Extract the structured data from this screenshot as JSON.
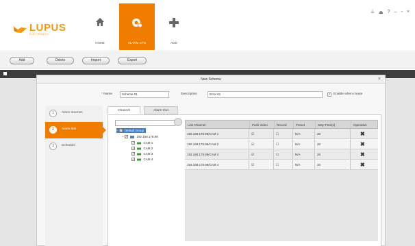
{
  "app": {
    "logo_text": "LUPUS",
    "logo_sub": "ELECTRONICS",
    "brand_color": "#f07c00",
    "window_controls": [
      "≟",
      "⏏",
      "?",
      "–",
      "▫",
      "×"
    ]
  },
  "nav": [
    {
      "label": "HOME",
      "icon": "home-icon",
      "active": false
    },
    {
      "label": "ALARM CFG",
      "icon": "alarm-config-icon",
      "active": true
    },
    {
      "label": "ADD",
      "icon": "plus-icon",
      "active": false
    }
  ],
  "toolbar": {
    "add_label": "Add",
    "delete_label": "Delete",
    "import_label": "Import",
    "export_label": "Export"
  },
  "dialog": {
    "title": "New Scheme",
    "close": "×",
    "name_label": "Name",
    "name_required": "*",
    "name_value": "Scheme 01",
    "description_label": "Description",
    "description_value": "Error 01",
    "enable_label": "Enable when create",
    "enable_checked": true
  },
  "steps": [
    {
      "num": "1",
      "label": "Alarm sources",
      "active": false
    },
    {
      "num": "2",
      "label": "Alarm link",
      "active": true
    },
    {
      "num": "3",
      "label": "Schedule",
      "active": false
    }
  ],
  "subtabs": [
    {
      "label": "Channel",
      "active": true
    },
    {
      "label": "Alarm Out",
      "active": false
    }
  ],
  "tree": {
    "root": "Default Group",
    "device": "192.168.178.99",
    "cams": [
      "CAM 1",
      "CAM 2",
      "CAM 3",
      "CAM 4"
    ]
  },
  "table": {
    "headers": [
      "Link Channel",
      "Push Video",
      "Record",
      "Preset",
      "Stay Time(s)",
      "Operation"
    ],
    "rows": [
      {
        "channel": "192.168.178.99/CAM 1",
        "push": "☑",
        "record": "☐",
        "preset": "N/A",
        "stay": "20",
        "op": "✖"
      },
      {
        "channel": "192.168.178.99/CAM 2",
        "push": "☑",
        "record": "☐",
        "preset": "N/A",
        "stay": "20",
        "op": "✖"
      },
      {
        "channel": "192.168.178.99/CAM 3",
        "push": "☑",
        "record": "☐",
        "preset": "N/A",
        "stay": "20",
        "op": "✖"
      },
      {
        "channel": "192.168.178.99/CAM 4",
        "push": "☑",
        "record": "☐",
        "preset": "N/A",
        "stay": "20",
        "op": "✖"
      }
    ]
  }
}
